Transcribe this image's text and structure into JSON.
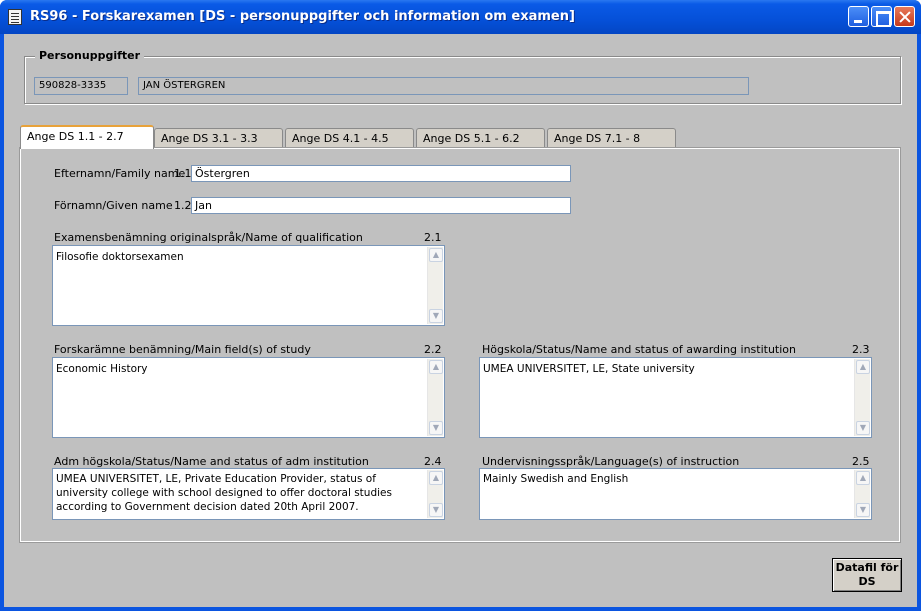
{
  "window": {
    "title": "RS96 - Forskarexamen [DS - personuppgifter och information om examen]"
  },
  "person": {
    "legend": "Personuppgifter",
    "personnummer": "590828-3335",
    "name": "JAN ÖSTERGREN"
  },
  "tabs": [
    {
      "label": "Ange DS  1.1 - 2.7",
      "active": true
    },
    {
      "label": "Ange DS  3.1 - 3.3",
      "active": false
    },
    {
      "label": "Ange DS  4.1 - 4.5",
      "active": false
    },
    {
      "label": "Ange DS  5.1 - 6.2",
      "active": false
    },
    {
      "label": "Ange DS  7.1 - 8",
      "active": false
    }
  ],
  "form": {
    "family_name": {
      "label": "Efternamn/Family name",
      "code": "1.1",
      "value": "Östergren"
    },
    "given_name": {
      "label": "Förnamn/Given name",
      "code": "1.2",
      "value": "Jan"
    },
    "qualification": {
      "label": "Examensbenämning originalspråk/Name of qualification",
      "code": "2.1",
      "value": "Filosofie doktorsexamen"
    },
    "main_field": {
      "label": "Forskarämne benämning/Main field(s) of study",
      "code": "2.2",
      "value": "Economic History"
    },
    "awarding_institution": {
      "label": "Högskola/Status/Name and status of awarding institution",
      "code": "2.3",
      "value": "UMEA UNIVERSITET, LE, State university"
    },
    "adm_institution": {
      "label": "Adm högskola/Status/Name and status of adm institution",
      "code": "2.4",
      "value": "UMEA UNIVERSITET, LE, Private Education Provider, status of university college with school designed to offer doctoral studies according to Government decision dated 20th April 2007."
    },
    "language": {
      "label": "Undervisningsspråk/Language(s) of instruction",
      "code": "2.5",
      "value": "Mainly Swedish and English"
    }
  },
  "buttons": {
    "datafil": "Datafil för\nDS"
  },
  "icons": {
    "scroll_up": "▲",
    "scroll_down": "▼"
  }
}
